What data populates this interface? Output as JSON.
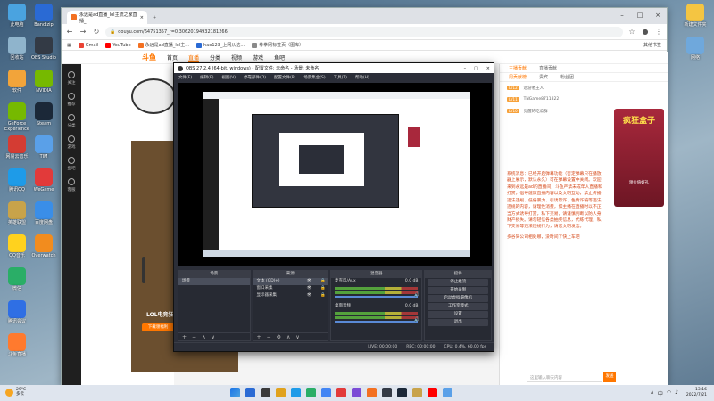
{
  "desktop": {
    "icons_left": [
      {
        "label": "此电脑",
        "color": "#4aa3e0"
      },
      {
        "label": "回收站",
        "color": "#8fb4cc"
      },
      {
        "label": "软件",
        "color": "#f2a43a"
      },
      {
        "label": "GeForce Experience",
        "color": "#76b900"
      },
      {
        "label": "网易云音乐",
        "color": "#d43c33"
      },
      {
        "label": "腾讯QQ",
        "color": "#1e9be8"
      },
      {
        "label": "英雄联盟",
        "color": "#c8a34a"
      },
      {
        "label": "QQ音乐",
        "color": "#ffd21e"
      },
      {
        "label": "微信",
        "color": "#2aae67"
      },
      {
        "label": "腾讯会议",
        "color": "#2f6fe4"
      },
      {
        "label": "斗鱼直播",
        "color": "#ff7a2e"
      }
    ],
    "icons_col2": [
      {
        "label": "Bandizip",
        "color": "#2a6ad4"
      },
      {
        "label": "OBS Studio",
        "color": "#333a45"
      },
      {
        "label": "NVIDIA",
        "color": "#76b900"
      },
      {
        "label": "Steam",
        "color": "#1b2838"
      },
      {
        "label": "TIM",
        "color": "#5aa0e8"
      },
      {
        "label": "WeGame",
        "color": "#e23a3a"
      },
      {
        "label": "百度网盘",
        "color": "#3a8ee8"
      },
      {
        "label": "Overwatch",
        "color": "#f28c1e"
      }
    ],
    "icons_right": [
      {
        "label": "新建文件夹",
        "color": "#f4c542"
      },
      {
        "label": "网络",
        "color": "#6fa8dc"
      }
    ]
  },
  "browser": {
    "tab_title": "永远是ad直播_lol主流之家直播_",
    "tab_close": "×",
    "new_tab": "+",
    "win_min": "–",
    "win_max": "□",
    "win_close": "×",
    "url": "douyu.com/64751357_r=0.30620194932181266",
    "bookmarks": [
      {
        "label": "Gmail",
        "color": "#ea4335"
      },
      {
        "label": "YouTube",
        "color": "#ff0000"
      },
      {
        "label": "永远是ad直播_lol主...",
        "color": "#f37021"
      },
      {
        "label": "hao123_上网从这...",
        "color": "#2a6ad4"
      },
      {
        "label": "拳拳网标签页（图库）",
        "color": "#8a8a8a"
      }
    ],
    "bookmarks_right": "其他书签"
  },
  "site": {
    "logo": "斗鱼",
    "nav": [
      "首页",
      "直播",
      "分类",
      "视频",
      "游戏",
      "鱼吧"
    ],
    "active_nav": "直播",
    "rail": [
      "关注",
      "推荐",
      "分类",
      "游戏",
      "鱼吧",
      "客服"
    ],
    "room_label": "LOL电竞狂摔",
    "follow_button": "下载领福利",
    "right_tabs": [
      "主播贡献",
      "直播贡献"
    ],
    "right_subtabs": [
      "周贡献榜",
      "贵宾",
      "粉丝团"
    ],
    "rank_rows": [
      {
        "badge": "LV12",
        "name": "巡游者王人"
      },
      {
        "badge": "LV11",
        "name": "TNGame8711822"
      },
      {
        "badge": "LV10",
        "name": "觉醒的吃瓜群"
      }
    ],
    "system_message": "系统消息：已经开启弹幕功能（否定弹幕只在播放器上展示，默认永久）可在弹幕设置中关闭。欢迎来到永远是ad的直播间，斗鱼严禁未成年人直播和打赏，倡导健康直播内容以及文明互动，禁止传播违法违规、低俗暴力、引诱欺诈、色情诈骗等违法违规的内容，请理性消费，如主播在直播时以不正当方式诱导打赏，私下交易，请谨慎判断以防人身财产损失。请勿轻信各类抽奖信息，代练代理，私下交易等违法违规行为，请您文明发言。",
    "welcome_message": "多谷同公司相处哪，没时间了快上车吧",
    "promo_title": "疯狂盒子",
    "promo_sub": "领价值好礼",
    "chat_placeholder": "这里输入聊天内容",
    "send_button": "发送"
  },
  "obs": {
    "title": "OBS 27.2.4 (64-bit, windows) - 配置文件: 未命名 - 场景: 未命名",
    "menu": [
      "文件(F)",
      "编辑(E)",
      "视图(V)",
      "停靠部件(D)",
      "配置文件(P)",
      "场景集合(S)",
      "工具(T)",
      "帮助(H)"
    ],
    "panels": {
      "scenes_head": "场景",
      "scenes": [
        "场景"
      ],
      "sources_head": "来源",
      "sources": [
        "文本 (GDI+)",
        "窗口采集",
        "显示器采集"
      ],
      "mixer_head": "混音器",
      "mixer_rows": [
        {
          "name": "麦克风/Aux",
          "db": "0.0 dB"
        },
        {
          "name": "桌面音频",
          "db": "0.0 dB"
        }
      ],
      "controls_head": "控件",
      "controls": [
        "停止推流",
        "开始录制",
        "启动虚拟摄像机",
        "工作室模式",
        "设置",
        "退出"
      ],
      "transitions_head": "转场特效"
    },
    "status": {
      "live": "LIVE: 00:00:00",
      "rec": "REC: 00:00:00",
      "cpu": "CPU: 0.4%, 60.00 fps"
    }
  },
  "taskbar": {
    "temperature": "29°C",
    "weather": "多云",
    "time": "13:16",
    "date": "2022/7/21",
    "tray": "中",
    "icon_colors": [
      "#2a6ad4",
      "#3a3a3a",
      "#e0a21e",
      "#1e9be8",
      "#2aae67",
      "#4285f4",
      "#e23a3a",
      "#7b4bd6",
      "#f37021",
      "#333a45",
      "#1b2838",
      "#c8a34a",
      "#ff0000",
      "#5aa0e8"
    ]
  }
}
